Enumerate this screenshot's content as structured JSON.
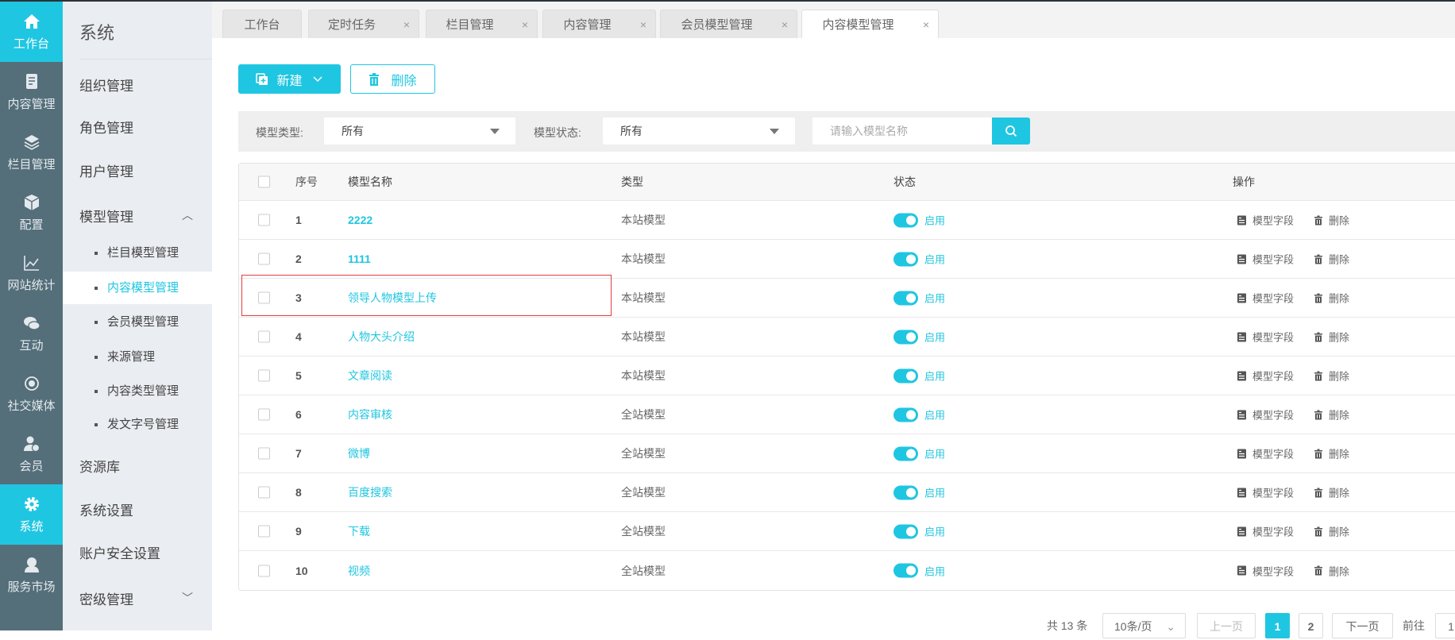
{
  "colors": {
    "accent": "#1fc6e1",
    "nav": "#546e7a",
    "highlight": "#e23c3c"
  },
  "nav1": [
    {
      "label": "工作台",
      "icon": "home-icon",
      "active": true
    },
    {
      "label": "内容管理",
      "icon": "document-icon"
    },
    {
      "label": "栏目管理",
      "icon": "layers-icon"
    },
    {
      "label": "配置",
      "icon": "box-icon"
    },
    {
      "label": "网站统计",
      "icon": "chart-icon"
    },
    {
      "label": "互动",
      "icon": "chat-icon"
    },
    {
      "label": "社交媒体",
      "icon": "social-icon"
    },
    {
      "label": "会员",
      "icon": "member-icon"
    },
    {
      "label": "系统",
      "icon": "gear-icon",
      "active": true
    },
    {
      "label": "服务市场",
      "icon": "service-icon"
    }
  ],
  "nav2": {
    "title": "系统",
    "items": [
      "组织管理",
      "角色管理",
      "用户管理",
      "模型管理"
    ],
    "sub": [
      "栏目模型管理",
      "内容模型管理",
      "会员模型管理",
      "来源管理",
      "内容类型管理",
      "发文字号管理"
    ],
    "items2": [
      "资源库",
      "系统设置",
      "账户安全设置",
      "密级管理"
    ]
  },
  "tabs": [
    {
      "label": "工作台"
    },
    {
      "label": "定时任务",
      "close": "×"
    },
    {
      "label": "栏目管理",
      "close": "×"
    },
    {
      "label": "内容管理",
      "close": "×"
    },
    {
      "label": "会员模型管理",
      "close": "×"
    },
    {
      "label": "内容模型管理",
      "close": "×"
    }
  ],
  "toolbar": {
    "new_label": "新建",
    "delete_label": "删除"
  },
  "filter": {
    "type_label": "模型类型:",
    "type_value": "所有",
    "status_label": "模型状态:",
    "status_value": "所有",
    "search_placeholder": "请输入模型名称"
  },
  "table": {
    "headers": {
      "no": "序号",
      "name": "模型名称",
      "type": "类型",
      "status": "状态",
      "ops": "操作"
    },
    "rows": [
      {
        "no": "1",
        "name": "2222",
        "type": "本站模型",
        "status": "启用"
      },
      {
        "no": "2",
        "name": "1111",
        "type": "本站模型",
        "status": "启用"
      },
      {
        "no": "3",
        "name": "领导人物模型上传",
        "type": "本站模型",
        "status": "启用"
      },
      {
        "no": "4",
        "name": "人物大头介绍",
        "type": "本站模型",
        "status": "启用"
      },
      {
        "no": "5",
        "name": "文章阅读",
        "type": "本站模型",
        "status": "启用"
      },
      {
        "no": "6",
        "name": "内容审核",
        "type": "全站模型",
        "status": "启用"
      },
      {
        "no": "7",
        "name": "微博",
        "type": "全站模型",
        "status": "启用"
      },
      {
        "no": "8",
        "name": "百度搜索",
        "type": "全站模型",
        "status": "启用"
      },
      {
        "no": "9",
        "name": "下载",
        "type": "全站模型",
        "status": "启用"
      },
      {
        "no": "10",
        "name": "视频",
        "type": "全站模型",
        "status": "启用"
      }
    ],
    "op_fields": "模型字段",
    "op_delete": "删除"
  },
  "pager": {
    "total": "共 13 条",
    "size": "10条/页",
    "prev": "上一页",
    "pages": [
      "1",
      "2"
    ],
    "next": "下一页",
    "goto": "前往",
    "goto_value": "1"
  }
}
